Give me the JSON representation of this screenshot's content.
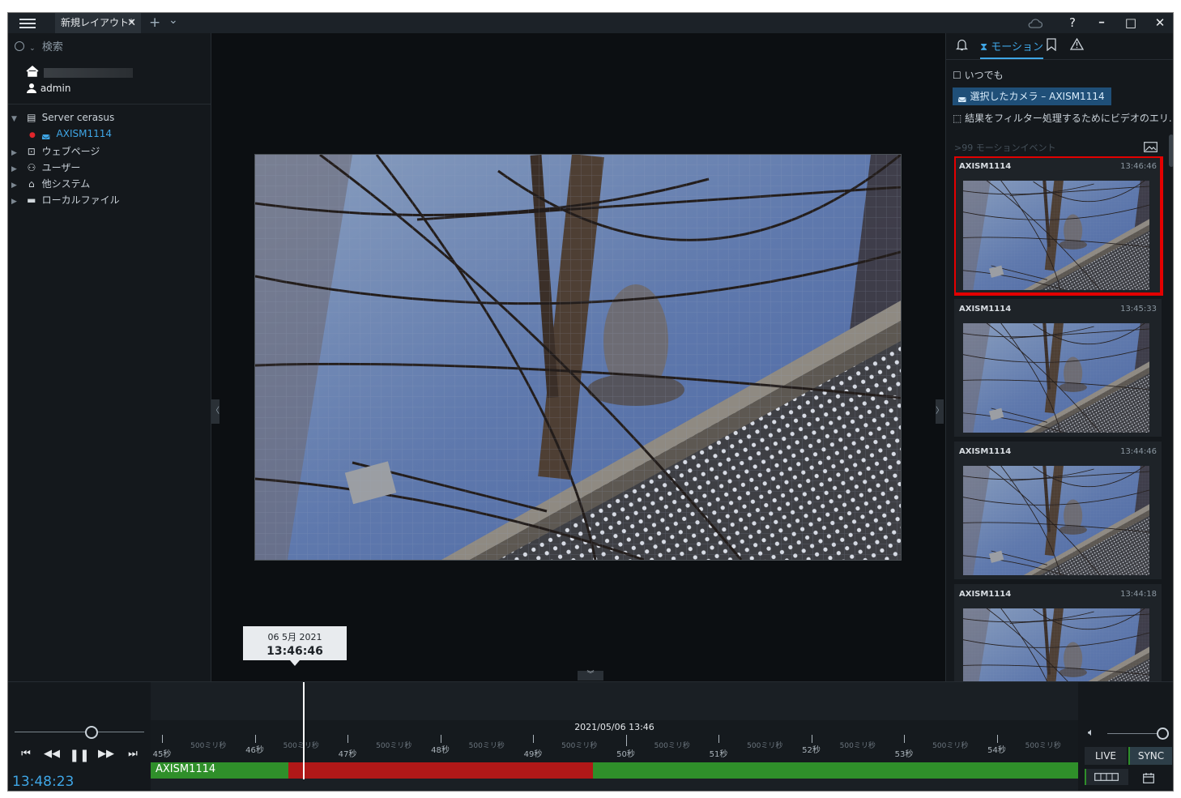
{
  "titlebar": {
    "tab_label": "新規レイアウト*",
    "close_tab": "✕",
    "add_tab": "+",
    "tab_menu": "⌄",
    "help": "?",
    "minimize": "━",
    "maximize": "□",
    "close": "✕"
  },
  "sidebar": {
    "search_placeholder": "検索",
    "user": "admin",
    "tree": [
      {
        "label": "Server cerasus",
        "icon": "server-icon"
      },
      {
        "label": "AXISM1114",
        "icon": "camera-icon"
      },
      {
        "label": "ウェブページ",
        "icon": "webpage-icon"
      },
      {
        "label": "ユーザー",
        "icon": "users-icon"
      },
      {
        "label": "他システム",
        "icon": "other-systems-icon"
      },
      {
        "label": "ローカルファイル",
        "icon": "folder-icon"
      }
    ]
  },
  "right_panel": {
    "tabs": {
      "motion": "モーション"
    },
    "filters": {
      "anytime": "いつでも",
      "selected_camera": "選択したカメラ – AXISM1114",
      "area_filter": "結果をフィルター処理するためにビデオのエリ..."
    },
    "events_header": ">99 モーションイベント",
    "events": [
      {
        "camera": "AXISM1114",
        "time": "13:46:46",
        "selected": true
      },
      {
        "camera": "AXISM1114",
        "time": "13:45:33",
        "selected": false
      },
      {
        "camera": "AXISM1114",
        "time": "13:44:46",
        "selected": false
      },
      {
        "camera": "AXISM1114",
        "time": "13:44:18",
        "selected": false
      }
    ]
  },
  "timeline": {
    "cursor_date": "06 5月 2021",
    "cursor_time": "13:46:46",
    "ruler_date": "2021/05/06 13:46",
    "seconds": [
      "45秒",
      "46秒",
      "47秒",
      "48秒",
      "49秒",
      "50秒",
      "51秒",
      "52秒",
      "53秒",
      "54秒"
    ],
    "half_label": "500ミリ秒",
    "track_label": "AXISM1114",
    "current_time": "13:48:23",
    "live_label": "LIVE",
    "sync_label": "SYNC"
  },
  "colors": {
    "accent": "#3fa6e6",
    "track_green": "#2f8f2a",
    "track_red": "#b01818",
    "selected_outline": "#e30000"
  }
}
